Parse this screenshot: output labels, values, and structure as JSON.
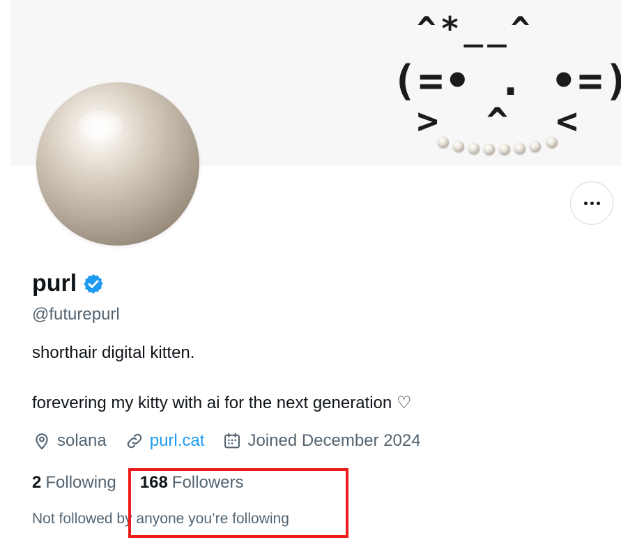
{
  "banner": {
    "kaomoji_line1": "^*__^",
    "kaomoji_line2": "(=• . •=)",
    "kaomoji_line3": ">  ^  <"
  },
  "profile": {
    "name": "purl",
    "handle": "@futurepurl",
    "bio_line1": "shorthair digital kitten.",
    "bio_line2": "forevering my kitty with ai for the next generation ♡",
    "location": "solana",
    "website": "purl.cat",
    "joined": "Joined December 2024",
    "following_count": "2",
    "following_label": "Following",
    "followers_count": "168",
    "followers_label": "Followers",
    "followed_by_note": "Not followed by anyone you’re following"
  },
  "colors": {
    "link": "#1d9bf0",
    "verified_badge": "#1d9bf0",
    "highlight_box": "#ee1c1c",
    "secondary_text": "#536471"
  },
  "icons": {
    "verified": "verified-badge-icon",
    "location": "location-pin-icon",
    "link": "link-icon",
    "calendar": "calendar-icon",
    "more": "more-horizontal-icon"
  }
}
